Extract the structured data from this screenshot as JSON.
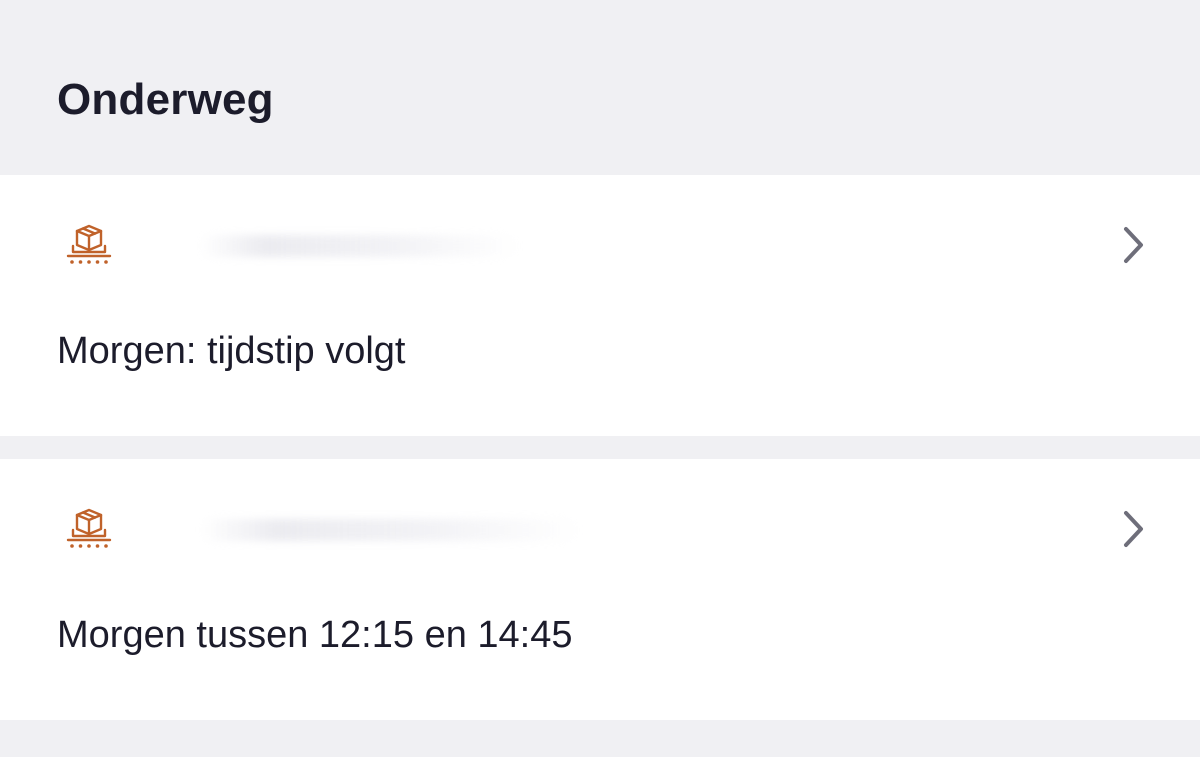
{
  "section": {
    "title": "Onderweg"
  },
  "shipments": [
    {
      "icon": "package-on-conveyor-icon",
      "delivery": "Morgen: tijdstip volgt"
    },
    {
      "icon": "package-on-conveyor-icon",
      "delivery": "Morgen tussen 12:15 en 14:45"
    }
  ],
  "colors": {
    "background": "#f0f0f3",
    "card": "#ffffff",
    "text": "#1c1c2b",
    "icon_accent": "#c0622a",
    "chevron": "#6e6e7a"
  }
}
